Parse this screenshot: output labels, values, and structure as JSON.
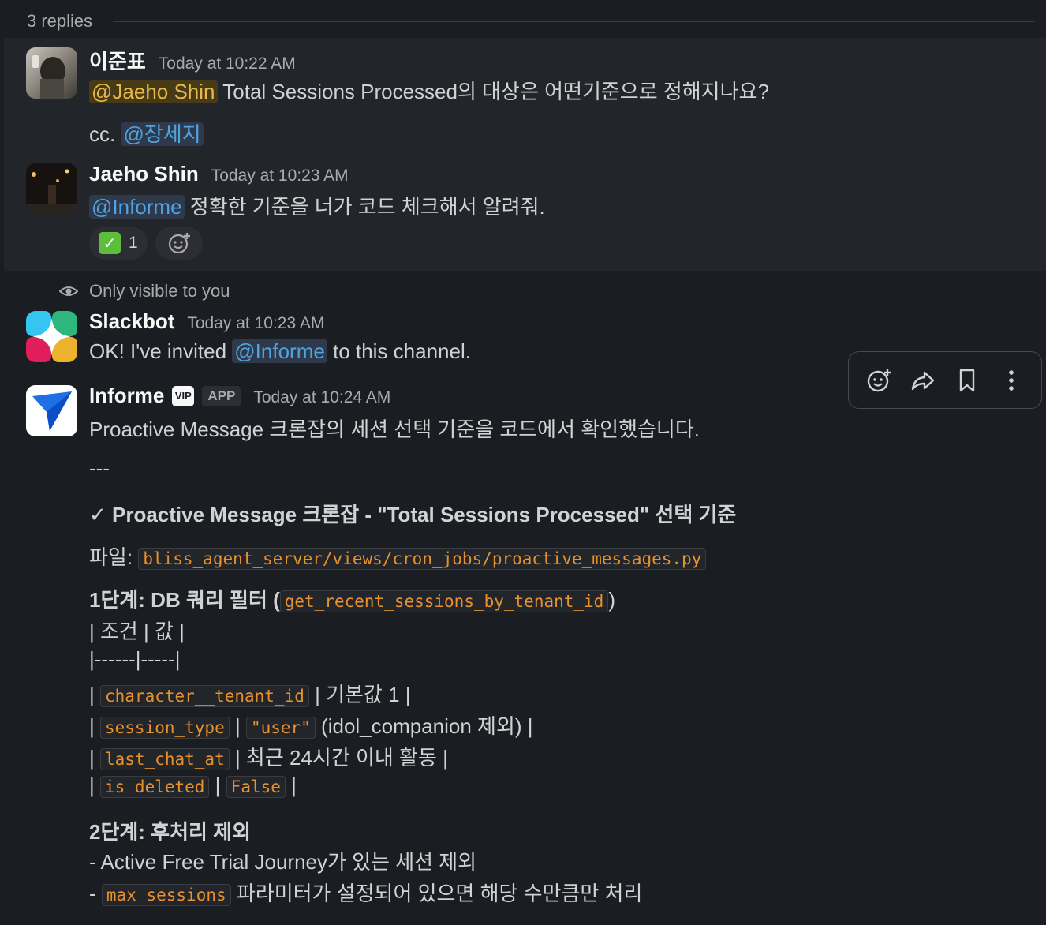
{
  "thread": {
    "replies_label": "3 replies"
  },
  "messages": [
    {
      "author": "이준표",
      "timestamp": "Today at 10:22 AM",
      "mention": "@Jaeho Shin",
      "text": "Total Sessions Processed의 대상은 어떤기준으로 정해지나요?",
      "cc_prefix": "cc.",
      "cc_mention": "@장세지"
    },
    {
      "author": "Jaeho Shin",
      "timestamp": "Today at 10:23 AM",
      "mention": "@Informe",
      "text": "정확한 기준을 너가 코드 체크해서 알려줘.",
      "reaction": {
        "emoji": "check-mark",
        "count": "1"
      }
    },
    {
      "visibility_note": "Only visible to you",
      "author": "Slackbot",
      "timestamp": "Today at 10:23 AM",
      "text_before": "OK! I've invited",
      "mention": "@Informe",
      "text_after": "to this channel."
    },
    {
      "author": "Informe",
      "badge_vip": "VIP",
      "badge_app": "APP",
      "timestamp": "Today at 10:24 AM",
      "intro": "Proactive Message 크론잡의 세션 선택 기준을 코드에서 확인했습니다.",
      "divider": "---",
      "title": "✓ Proactive Message 크론잡 - \"Total Sessions Processed\" 선택 기준",
      "file_label": "파일:",
      "file_path": "bliss_agent_server/views/cron_jobs/proactive_messages.py",
      "step1_title": "1단계: DB 쿼리 필터 (",
      "step1_func": "get_recent_sessions_by_tenant_id",
      "step1_close": ")",
      "table_header": "| 조건 | 값 |",
      "table_sep": "|------|-----|",
      "rows": [
        {
          "field": "character__tenant_id",
          "value_code": "",
          "value_text": "| 기본값 1 |"
        },
        {
          "field": "session_type",
          "value_code": "\"user\"",
          "value_text": "(idol_companion 제외) |"
        },
        {
          "field": "last_chat_at",
          "value_code": "",
          "value_text": "| 최근 24시간 이내 활동 |"
        },
        {
          "field": "is_deleted",
          "value_code": "False",
          "value_text": "|"
        }
      ],
      "step2_title": "2단계: 후처리 제외",
      "step2_item1": "- Active Free Trial Journey가 있는 세션 제외",
      "step2_item2_prefix": "-",
      "step2_item2_code": "max_sessions",
      "step2_item2_text": "파라미터가 설정되어 있으면 해당 수만큼만 처리"
    }
  ],
  "colors": {
    "background": "#1a1d21",
    "highlight": "#222529",
    "mention": "#4fa3e0",
    "self_mention": "#e8b84a",
    "code": "#e8912d"
  }
}
